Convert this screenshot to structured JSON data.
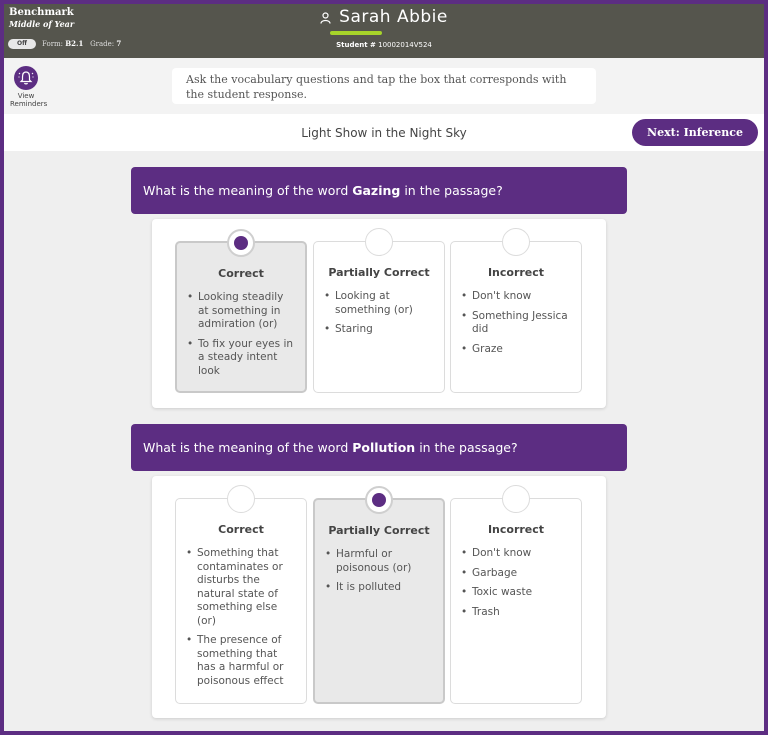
{
  "header": {
    "assessment": "Benchmark",
    "period": "Middle of Year",
    "toggle_label": "Off",
    "form_label": "Form:",
    "form_value": "B2.1",
    "grade_label": "Grade:",
    "grade_value": "7",
    "student_name": "Sarah Abbie",
    "student_id_label": "Student #",
    "student_id": "10002014V524"
  },
  "reminders": {
    "label_line1": "View",
    "label_line2": "Reminders"
  },
  "instruction": "Ask the vocabulary questions and tap the box that corresponds with the student response.",
  "passage": {
    "title": "Light Show in the Night Sky",
    "next_button": "Next: Inference"
  },
  "questions": [
    {
      "prefix": "What is the meaning of the word",
      "word": "Gazing",
      "suffix": "in the passage?",
      "selected": "correct",
      "options": [
        {
          "title": "Correct",
          "items": [
            "Looking steadily at something in admiration (or)",
            "To fix your eyes in a steady intent look"
          ]
        },
        {
          "title": "Partially Correct",
          "items": [
            "Looking at something (or)",
            "Staring"
          ]
        },
        {
          "title": "Incorrect",
          "items": [
            "Don't know",
            "Something Jessica did",
            "Graze"
          ]
        }
      ]
    },
    {
      "prefix": "What is the meaning of the word",
      "word": "Pollution",
      "suffix": "in the passage?",
      "selected": "partially_correct",
      "options": [
        {
          "title": "Correct",
          "items": [
            "Something that contaminates or disturbs the natural state of something else (or)",
            "The presence of something that has a harmful or poisonous effect"
          ]
        },
        {
          "title": "Partially Correct",
          "items": [
            "Harmful or poisonous (or)",
            "It is polluted"
          ]
        },
        {
          "title": "Incorrect",
          "items": [
            "Don't know",
            "Garbage",
            "Toxic waste",
            "Trash"
          ]
        }
      ]
    }
  ],
  "colors": {
    "brand_purple": "#5c2d82",
    "header_bg": "#55554d",
    "accent_green": "#a7d42a"
  },
  "icons": {
    "student": "person-icon",
    "reminders": "bell-icon"
  }
}
